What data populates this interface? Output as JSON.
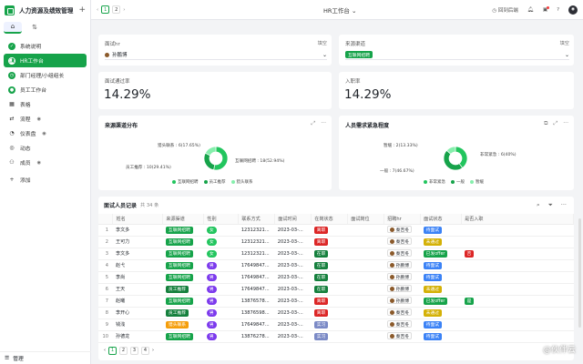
{
  "app": {
    "title": "人力资源及绩效管理",
    "workspace_title": "HR工作台",
    "back_label": "回到后端"
  },
  "sidebar": {
    "items": [
      {
        "label": "系统说明",
        "icon": "check-circle-icon",
        "color": "#16a34a",
        "eye": false
      },
      {
        "label": "HR工作台",
        "icon": "people-icon",
        "color": "#16a34a",
        "eye": false,
        "active": true
      },
      {
        "label": "部门经理/小组组长",
        "icon": "clock-icon",
        "color": "#16a34a",
        "eye": false
      },
      {
        "label": "员工工作台",
        "icon": "person-icon",
        "color": "#16a34a",
        "eye": false
      },
      {
        "label": "表格",
        "icon": "grid-icon",
        "color": "#333333",
        "eye": false
      },
      {
        "label": "流程",
        "icon": "flow-icon",
        "color": "#333333",
        "eye": true
      },
      {
        "label": "仪表盘",
        "icon": "dashboard-icon",
        "color": "#333333",
        "eye": true
      },
      {
        "label": "动态",
        "icon": "activity-icon",
        "color": "#333333",
        "eye": false
      },
      {
        "label": "成员",
        "icon": "members-icon",
        "color": "#333333",
        "eye": true
      },
      {
        "label": "添加",
        "icon": "plus-icon",
        "color": "#333333",
        "eye": false
      }
    ],
    "footer_label": "管理"
  },
  "filters": {
    "hr_label": "面试hr",
    "hr_kind": "填空",
    "hr_value": "孙鹏博",
    "channel_label": "来源渠道",
    "channel_kind": "填空",
    "channel_value": "互联网招聘"
  },
  "stats": {
    "pass_label": "面试通过率",
    "pass_value": "14.29%",
    "entry_label": "入职率",
    "entry_value": "14.29%"
  },
  "pie_source": {
    "title": "来源渠道分布",
    "label_top": "猎头联系 : 6(17.65%)",
    "label_left": "员工推荐 : 10(29.41%)",
    "label_right": "互联网招聘 : 18(52.94%)",
    "legend": [
      "互联网招聘",
      "员工推荐",
      "猎头联系"
    ]
  },
  "pie_urgency": {
    "title": "人员需求紧急程度",
    "label_top": "暂缓 : 2(13.33%)",
    "label_left": "一般 : 7(46.67%)",
    "label_right": "非常紧急 : 6(40%)",
    "legend": [
      "非常紧急",
      "一般",
      "暂缓"
    ]
  },
  "chart_data": [
    {
      "type": "pie",
      "title": "来源渠道分布",
      "categories": [
        "互联网招聘",
        "员工推荐",
        "猎头联系"
      ],
      "values": [
        18,
        10,
        6
      ],
      "colors": [
        "#22c55e",
        "#16a34a",
        "#86efac"
      ]
    },
    {
      "type": "pie",
      "title": "人员需求紧急程度",
      "categories": [
        "非常紧急",
        "一般",
        "暂缓"
      ],
      "values": [
        6,
        7,
        2
      ],
      "colors": [
        "#22c55e",
        "#16a34a",
        "#86efac"
      ]
    }
  ],
  "table": {
    "title": "面试人员记录",
    "count": "共 34 条",
    "headers": [
      "姓名",
      "来源渠道",
      "性别",
      "联系方式",
      "面试时间",
      "在岗状态",
      "面试岗位",
      "招聘hr",
      "面试状态",
      "是否入职"
    ],
    "rows": [
      {
        "n": "1",
        "name": "李文多",
        "ch": "互联网招聘",
        "chc": "g",
        "sex": "女",
        "sc": "gl",
        "phone": "12312321...",
        "time": "2023-03-...",
        "st": "离职",
        "stc": "rd",
        "hr": "秦吉冬",
        "ist": "待面试",
        "istc": "bl",
        "hire": "",
        "hirec": ""
      },
      {
        "n": "2",
        "name": "王可力",
        "ch": "互联网招聘",
        "chc": "g",
        "sex": "女",
        "sc": "gl",
        "phone": "12312321...",
        "time": "2023-03-...",
        "st": "离职",
        "stc": "rd",
        "hr": "秦吉冬",
        "ist": "未通过",
        "istc": "yl",
        "hire": "",
        "hirec": ""
      },
      {
        "n": "3",
        "name": "李文多",
        "ch": "互联网招聘",
        "chc": "g",
        "sex": "女",
        "sc": "gl",
        "phone": "12312321...",
        "time": "2023-03-...",
        "st": "在职",
        "stc": "gd",
        "hr": "秦吉冬",
        "ist": "已发offer",
        "istc": "g",
        "hire": "否",
        "hirec": "rd"
      },
      {
        "n": "4",
        "name": "赵弋",
        "ch": "互联网招聘",
        "chc": "g",
        "sex": "男",
        "sc": "pu",
        "phone": "17649847...",
        "time": "2023-03-...",
        "st": "在职",
        "stc": "gd",
        "hr": "孙鹏博",
        "ist": "待面试",
        "istc": "bl",
        "hire": "",
        "hirec": ""
      },
      {
        "n": "5",
        "name": "李尚",
        "ch": "互联网招聘",
        "chc": "g",
        "sex": "男",
        "sc": "pu",
        "phone": "17649847...",
        "time": "2023-03-...",
        "st": "在职",
        "stc": "gd",
        "hr": "孙鹏博",
        "ist": "待面试",
        "istc": "bl",
        "hire": "",
        "hirec": ""
      },
      {
        "n": "6",
        "name": "王天",
        "ch": "员工推荐",
        "chc": "gd",
        "sex": "男",
        "sc": "pu",
        "phone": "17649847...",
        "time": "2023-03-...",
        "st": "在职",
        "stc": "gd",
        "hr": "孙鹏博",
        "ist": "未通过",
        "istc": "yl",
        "hire": "",
        "hirec": ""
      },
      {
        "n": "7",
        "name": "赵曦",
        "ch": "互联网招聘",
        "chc": "g",
        "sex": "男",
        "sc": "pu",
        "phone": "13876578...",
        "time": "2023-03-...",
        "st": "离职",
        "stc": "rd",
        "hr": "孙鹏博",
        "ist": "已发offer",
        "istc": "g",
        "hire": "是",
        "hirec": "g"
      },
      {
        "n": "8",
        "name": "李开心",
        "ch": "员工推荐",
        "chc": "gd",
        "sex": "男",
        "sc": "pu",
        "phone": "13876598...",
        "time": "2023-03-...",
        "st": "离职",
        "stc": "rd",
        "hr": "秦吉冬",
        "ist": "未通过",
        "istc": "yl",
        "hire": "",
        "hirec": ""
      },
      {
        "n": "9",
        "name": "钱浅",
        "ch": "猎头联系",
        "chc": "or",
        "sex": "男",
        "sc": "pu",
        "phone": "17649847...",
        "time": "2023-03-...",
        "st": "实习",
        "stc": "ch",
        "hr": "秦吉冬",
        "ist": "待面试",
        "istc": "bl",
        "hire": "",
        "hirec": ""
      },
      {
        "n": "10",
        "name": "孙德龙",
        "ch": "互联网招聘",
        "chc": "g",
        "sex": "男",
        "sc": "pu",
        "phone": "13876278...",
        "time": "2023-03-...",
        "st": "实习",
        "stc": "ch",
        "hr": "秦吉冬",
        "ist": "待面试",
        "istc": "bl",
        "hire": "",
        "hirec": ""
      }
    ],
    "pages": [
      "1",
      "2",
      "3",
      "4"
    ]
  },
  "top_pager": [
    "1",
    "2"
  ],
  "watermark": "@伙伴云"
}
